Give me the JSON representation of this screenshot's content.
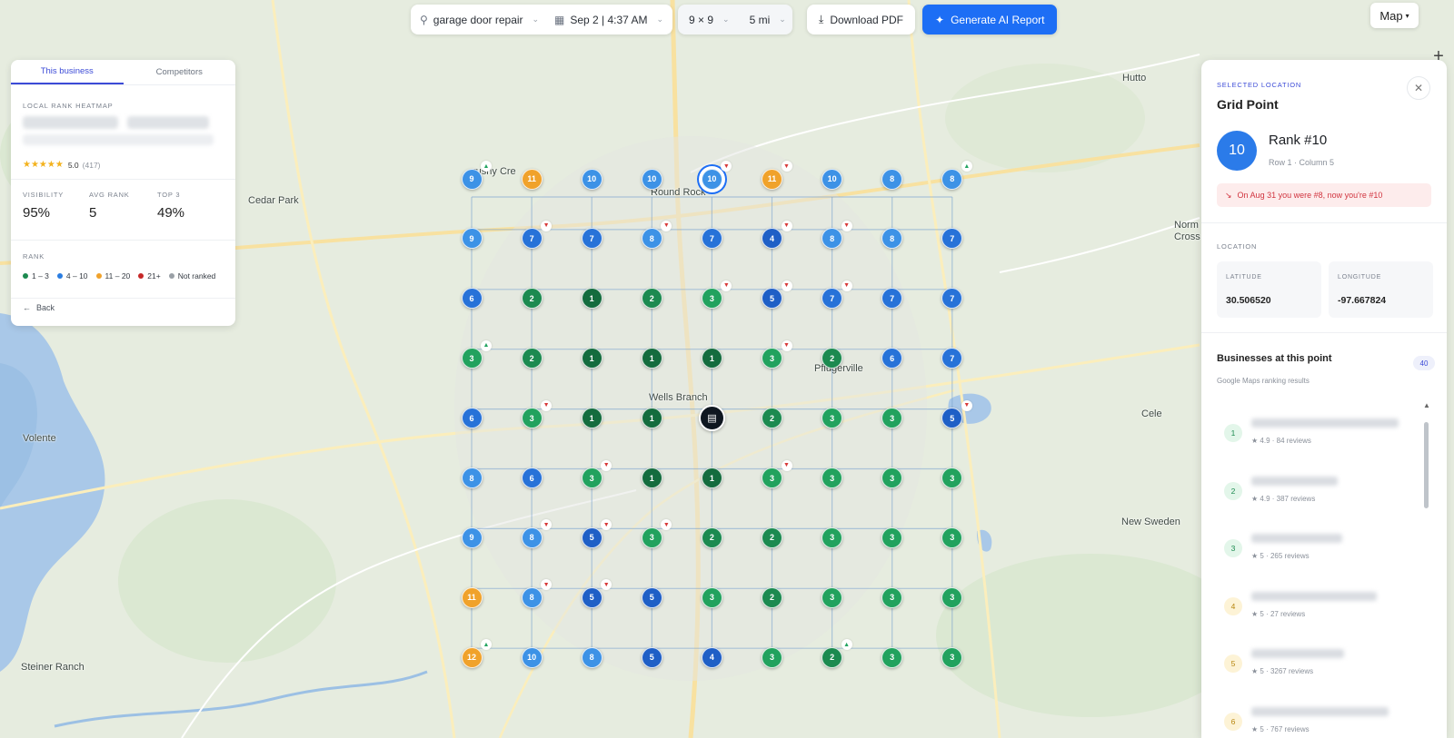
{
  "toolbar": {
    "keyword": "garage door repair",
    "date_time": "Sep 2 | 4:37 AM",
    "grid_size": "9 × 9",
    "radius": "5 mi",
    "download_label": "Download PDF",
    "report_label": "Generate AI Report",
    "map_type": "Map"
  },
  "map_places": {
    "brushy": "rushy Cre",
    "cedar_park": "Cedar Park",
    "round_rock": "Round Rock",
    "hutto": "Hutto",
    "norm": "Norm",
    "cross": "Cross",
    "pflugerville": "Pflugerville",
    "wells_branch": "Wells Branch",
    "cele": "Cele",
    "volente": "Volente",
    "new_sweden": "New Sweden",
    "steiner_ranch": "Steiner Ranch"
  },
  "left_panel": {
    "tabs": [
      "This business",
      "Competitors"
    ],
    "heatmap_label": "LOCAL RANK HEATMAP",
    "rating": "5.0",
    "review_count": "(417)",
    "stats": [
      {
        "label": "VISIBILITY",
        "value": "95%"
      },
      {
        "label": "AVG RANK",
        "value": "5"
      },
      {
        "label": "TOP 3",
        "value": "49%"
      }
    ],
    "rank_label": "RANK",
    "legend": [
      {
        "label": "1 – 3",
        "color": "#1c8a50"
      },
      {
        "label": "4 – 10",
        "color": "#2a7de1"
      },
      {
        "label": "11 – 20",
        "color": "#f0a22b"
      },
      {
        "label": "21+",
        "color": "#c62828"
      },
      {
        "label": "Not ranked",
        "color": "#9aa0a6"
      }
    ],
    "back_label": "Back"
  },
  "grid": {
    "ranks": [
      [
        9,
        11,
        10,
        10,
        10,
        11,
        10,
        8,
        8
      ],
      [
        9,
        7,
        7,
        8,
        7,
        4,
        8,
        8,
        7
      ],
      [
        6,
        2,
        1,
        2,
        3,
        5,
        7,
        7,
        7
      ],
      [
        3,
        2,
        1,
        1,
        1,
        3,
        2,
        6,
        7
      ],
      [
        6,
        3,
        1,
        1,
        null,
        2,
        3,
        3,
        5
      ],
      [
        8,
        6,
        3,
        1,
        1,
        3,
        3,
        3,
        3
      ],
      [
        9,
        8,
        5,
        3,
        2,
        2,
        3,
        3,
        3
      ],
      [
        11,
        8,
        5,
        5,
        3,
        2,
        3,
        3,
        3
      ],
      [
        12,
        10,
        8,
        5,
        4,
        3,
        2,
        3,
        3
      ]
    ],
    "trends": [
      {
        "row": 0,
        "col": 0,
        "dir": "up"
      },
      {
        "row": 0,
        "col": 4,
        "dir": "down"
      },
      {
        "row": 0,
        "col": 5,
        "dir": "down"
      },
      {
        "row": 0,
        "col": 8,
        "dir": "up"
      },
      {
        "row": 1,
        "col": 1,
        "dir": "down"
      },
      {
        "row": 1,
        "col": 3,
        "dir": "down"
      },
      {
        "row": 1,
        "col": 5,
        "dir": "down"
      },
      {
        "row": 1,
        "col": 6,
        "dir": "down"
      },
      {
        "row": 2,
        "col": 4,
        "dir": "down"
      },
      {
        "row": 2,
        "col": 5,
        "dir": "down"
      },
      {
        "row": 2,
        "col": 6,
        "dir": "down"
      },
      {
        "row": 3,
        "col": 0,
        "dir": "up"
      },
      {
        "row": 3,
        "col": 5,
        "dir": "down"
      },
      {
        "row": 4,
        "col": 1,
        "dir": "down"
      },
      {
        "row": 4,
        "col": 8,
        "dir": "down"
      },
      {
        "row": 5,
        "col": 2,
        "dir": "down"
      },
      {
        "row": 5,
        "col": 5,
        "dir": "down"
      },
      {
        "row": 6,
        "col": 1,
        "dir": "down"
      },
      {
        "row": 6,
        "col": 2,
        "dir": "down"
      },
      {
        "row": 6,
        "col": 3,
        "dir": "down"
      },
      {
        "row": 7,
        "col": 1,
        "dir": "down"
      },
      {
        "row": 7,
        "col": 2,
        "dir": "down"
      },
      {
        "row": 8,
        "col": 0,
        "dir": "up"
      },
      {
        "row": 8,
        "col": 6,
        "dir": "up"
      }
    ],
    "selected": {
      "row": 0,
      "col": 4
    },
    "center": {
      "row": 4,
      "col": 4
    }
  },
  "right_panel": {
    "eyebrow": "SELECTED LOCATION",
    "title": "Grid Point",
    "rank_value": "10",
    "rank_text": "Rank #10",
    "row_col": "Row 1 · Column 5",
    "alert": "On Aug 31 you were #8, now you're #10",
    "location_label": "LOCATION",
    "latitude_label": "LATITUDE",
    "latitude": "30.506520",
    "longitude_label": "LONGITUDE",
    "longitude": "-97.667824",
    "businesses_title": "Businesses at this point",
    "businesses_count": "40",
    "businesses_sub": "Google Maps ranking results",
    "businesses": [
      {
        "rank": "1",
        "meta": "★ 4.9 · 84 reviews",
        "tone": "green"
      },
      {
        "rank": "2",
        "meta": "★ 4.9 · 387 reviews",
        "tone": "green"
      },
      {
        "rank": "3",
        "meta": "★ 5 · 265 reviews",
        "tone": "green"
      },
      {
        "rank": "4",
        "meta": "★ 5 · 27 reviews",
        "tone": "yellow"
      },
      {
        "rank": "5",
        "meta": "★ 5 · 3267 reviews",
        "tone": "yellow"
      },
      {
        "rank": "6",
        "meta": "★ 5 · 767 reviews",
        "tone": "yellow"
      }
    ]
  }
}
